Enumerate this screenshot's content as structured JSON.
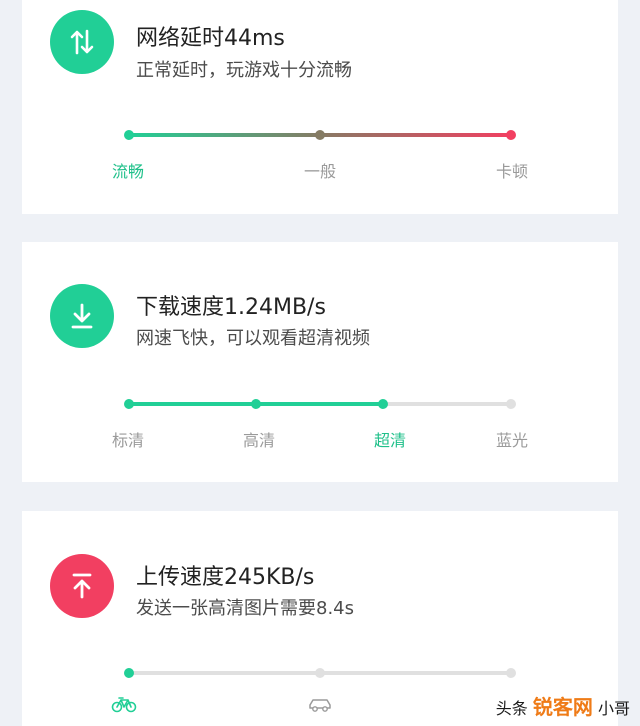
{
  "latency": {
    "title": "网络延时44ms",
    "subtitle": "正常延时，玩游戏十分流畅",
    "levels": [
      "流畅",
      "一般",
      "卡顿"
    ],
    "active_level": "流畅",
    "icon": "swap-vertical-arrows-icon"
  },
  "download": {
    "title": "下载速度1.24MB/s",
    "subtitle": "网速飞快，可以观看超清视频",
    "levels": [
      "标清",
      "高清",
      "超清",
      "蓝光"
    ],
    "active_level": "超清",
    "progress_steps": 3,
    "icon": "download-icon"
  },
  "upload": {
    "title": "上传速度245KB/s",
    "subtitle": "发送一张高清图片需要8.4s",
    "levels": [
      "bicycle-icon",
      "car-icon"
    ],
    "active_level": "bicycle-icon",
    "progress_steps": 1,
    "icon": "upload-icon"
  },
  "watermark": {
    "text_left": "头条",
    "brand": "锐客网",
    "text_right": "小哥"
  },
  "colors": {
    "green": "#21cf96",
    "red": "#f23f61",
    "gray_track": "#e0e0e0",
    "background": "#eef1f6"
  }
}
